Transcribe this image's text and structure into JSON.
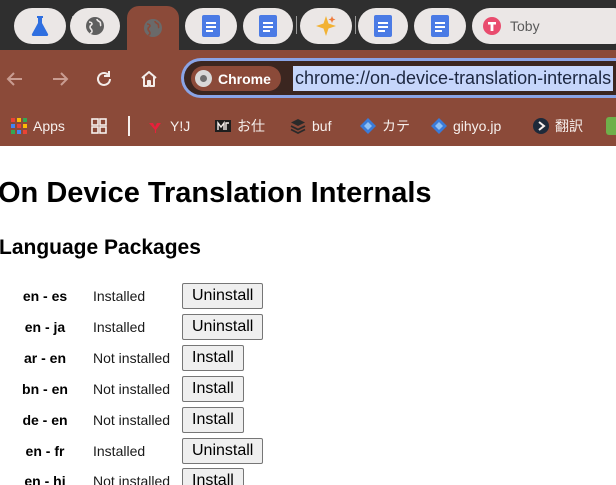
{
  "tabs": [
    {
      "icon": "flask-icon",
      "label": ""
    },
    {
      "icon": "globe-icon",
      "label": ""
    },
    {
      "icon": "globe-icon",
      "label": "",
      "active": true
    },
    {
      "icon": "docs-icon",
      "label": ""
    },
    {
      "icon": "docs-icon",
      "label": ""
    },
    {
      "icon": "sparkle-icon",
      "label": ""
    },
    {
      "icon": "docs-icon",
      "label": ""
    },
    {
      "icon": "docs-icon",
      "label": ""
    },
    {
      "icon": "toby-icon",
      "label": "Toby"
    }
  ],
  "toolbar": {
    "chip_label": "Chrome",
    "url": "chrome://on-device-translation-internals"
  },
  "bookmarks": [
    {
      "label": "Apps",
      "icon": "apps-grid-icon"
    },
    {
      "label": "",
      "icon": "grid-icon"
    },
    {
      "label": "Y!J",
      "icon": "yahoo-icon"
    },
    {
      "label": "お仕",
      "icon": "mf-icon"
    },
    {
      "label": "buf",
      "icon": "stack-icon"
    },
    {
      "label": "カテ",
      "icon": "diamond-icon"
    },
    {
      "label": "gihyo.jp",
      "icon": "diamond-icon"
    },
    {
      "label": "翻訳",
      "icon": "translate-icon"
    }
  ],
  "page": {
    "title": "On Device Translation Internals",
    "section_title": "Language Packages"
  },
  "packages": [
    {
      "pair": "en - es",
      "status": "Installed",
      "action": "Uninstall"
    },
    {
      "pair": "en - ja",
      "status": "Installed",
      "action": "Uninstall"
    },
    {
      "pair": "ar - en",
      "status": "Not installed",
      "action": "Install"
    },
    {
      "pair": "bn - en",
      "status": "Not installed",
      "action": "Install"
    },
    {
      "pair": "de - en",
      "status": "Not installed",
      "action": "Install"
    },
    {
      "pair": "en - fr",
      "status": "Installed",
      "action": "Uninstall"
    },
    {
      "pair": "en - hi",
      "status": "Not installed",
      "action": "Install"
    }
  ],
  "colors": {
    "toolbar": "#8b4a39",
    "tabstrip": "#2f2f2f",
    "url_highlight": "#c6d6fb"
  }
}
